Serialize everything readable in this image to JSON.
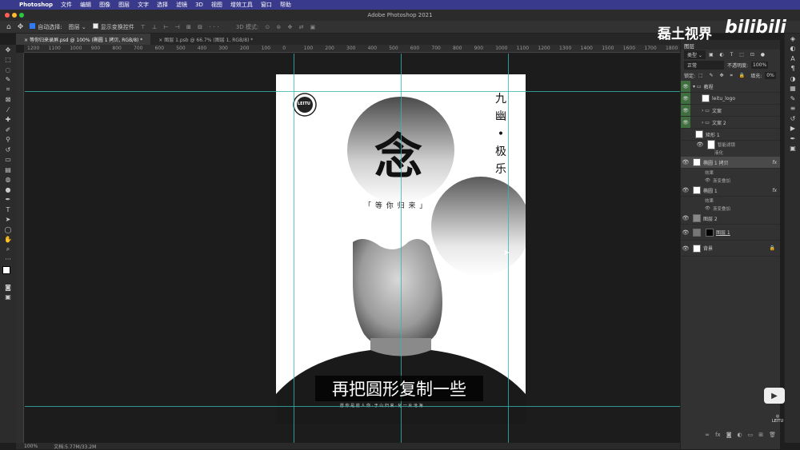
{
  "menubar": {
    "app": "Photoshop",
    "items": [
      "文件",
      "编辑",
      "图像",
      "图层",
      "文字",
      "选择",
      "滤镜",
      "3D",
      "视图",
      "增效工具",
      "窗口",
      "帮助"
    ]
  },
  "window": {
    "title": "Adobe Photoshop 2021"
  },
  "options": {
    "auto_select": "自动选择:",
    "target": "图层",
    "show_transform": "显示变换控件",
    "mode3d": "3D 模式:"
  },
  "tabs": [
    {
      "label": "等你归来录屏.psd @ 100% (椭圆 1 拷贝, RGB/8) *"
    },
    {
      "label": "图层 1.psb @ 66.7% (图层 1, RGB/8) *"
    }
  ],
  "ruler_ticks": [
    "1200",
    "1100",
    "1000",
    "900",
    "800",
    "700",
    "600",
    "500",
    "400",
    "300",
    "200",
    "100",
    "0",
    "100",
    "200",
    "300",
    "400",
    "500",
    "600",
    "700",
    "800",
    "900",
    "1000",
    "1100",
    "1200",
    "1300",
    "1400",
    "1500",
    "1600",
    "1700",
    "1800"
  ],
  "poster": {
    "logo": "LEITU",
    "big_char": "念",
    "vertical_text": [
      "九",
      "幽",
      "•",
      "极",
      "乐"
    ],
    "tagline": "「 等 你 归 来 」",
    "bottom_line": "愿 你 是 前 人 你 · 于 山 归 来 · 化 一 片 沧 海"
  },
  "subtitle": "再把圆形复制一些",
  "watermark": {
    "channel": "磊土视界",
    "site": "bilibili"
  },
  "status": {
    "zoom": "100%",
    "doc": "文档:5.77M/33.2M"
  },
  "layers": {
    "title": "图层",
    "kind": "类型",
    "blend": "正常",
    "opacity_label": "不透明度:",
    "opacity": "100%",
    "lock_label": "锁定:",
    "fill_label": "填充:",
    "fill": "0%",
    "rows": [
      {
        "name": "教程",
        "type": "group"
      },
      {
        "name": "leitu_logo",
        "type": "layer"
      },
      {
        "name": "文案",
        "type": "group"
      },
      {
        "name": "文案 2",
        "type": "group"
      },
      {
        "name": "矩形 1",
        "type": "layer"
      },
      {
        "name": "智能滤镜",
        "type": "sub"
      },
      {
        "name": "液化",
        "type": "sub"
      },
      {
        "name": "椭圆 1 拷贝",
        "type": "layer",
        "fx": "fx"
      },
      {
        "name": "效果",
        "type": "sub"
      },
      {
        "name": "渐变叠加",
        "type": "sub"
      },
      {
        "name": "椭圆 1",
        "type": "layer",
        "fx": "fx"
      },
      {
        "name": "效果",
        "type": "sub"
      },
      {
        "name": "渐变叠加",
        "type": "sub"
      },
      {
        "name": "图层 2",
        "type": "layer"
      },
      {
        "name": "图层 1",
        "type": "layer"
      },
      {
        "name": "背景",
        "type": "layer"
      }
    ]
  }
}
